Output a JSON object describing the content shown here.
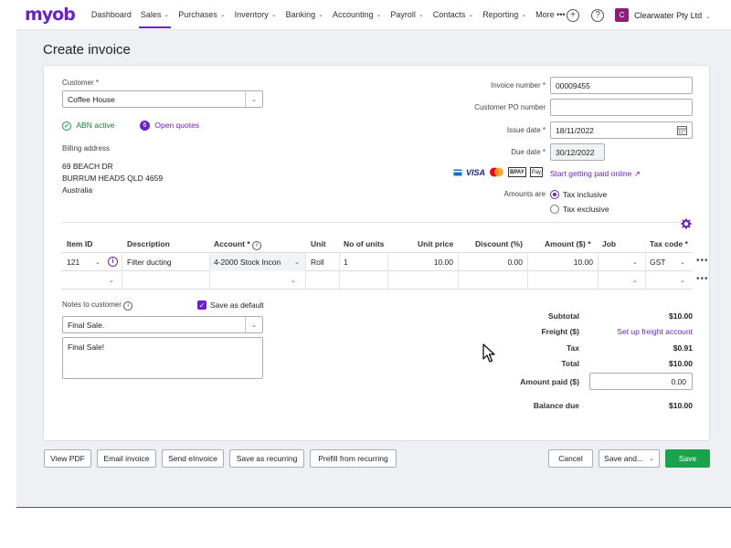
{
  "brand": {
    "logo": "myob",
    "accent": "#6b22c8"
  },
  "nav": {
    "items": [
      {
        "label": "Dashboard",
        "chev": ""
      },
      {
        "label": "Sales",
        "chev": "⌄"
      },
      {
        "label": "Purchases",
        "chev": "⌄"
      },
      {
        "label": "Inventory",
        "chev": "⌄"
      },
      {
        "label": "Banking",
        "chev": "⌄"
      },
      {
        "label": "Accounting",
        "chev": "⌄"
      },
      {
        "label": "Payroll",
        "chev": "⌄"
      },
      {
        "label": "Contacts",
        "chev": "⌄"
      },
      {
        "label": "Reporting",
        "chev": "⌄"
      },
      {
        "label": "More •••",
        "chev": ""
      }
    ],
    "company_initial": "C",
    "company_name": "Clearwater Pty Ltd",
    "add_icon": "+",
    "help_icon": "?"
  },
  "page": {
    "title": "Create invoice"
  },
  "customer": {
    "label": "Customer *",
    "value": "Coffee House",
    "abn_status": "ABN active",
    "quotes_count": "6",
    "quotes_label": "Open quotes",
    "billing_label": "Billing address",
    "address": [
      "69 BEACH DR",
      "BURRUM HEADS QLD 4659",
      "Australia"
    ]
  },
  "invoice": {
    "number_label": "Invoice number *",
    "number": "00009455",
    "po_label": "Customer PO number",
    "po_value": "",
    "issue_label": "Issue date *",
    "issue_date": "18/11/2022",
    "due_label": "Due date *",
    "due_date": "30/12/2022",
    "pay_online": "Start getting paid online",
    "amounts_label": "Amounts are",
    "tax_inclusive": "Tax inclusive",
    "tax_exclusive": "Tax exclusive"
  },
  "table": {
    "headers": {
      "item_id": "Item ID",
      "description": "Description",
      "account": "Account *",
      "unit": "Unit",
      "units": "No of units",
      "price": "Unit price",
      "discount": "Discount (%)",
      "amount": "Amount ($) *",
      "job": "Job",
      "tax": "Tax code *"
    },
    "row1": {
      "item_id": "121",
      "description": "Filter ducting",
      "account": "4-2000  Stock Incon",
      "unit": "Roll",
      "units": "1",
      "price": "10.00",
      "discount": "0.00",
      "amount": "10.00",
      "job": "",
      "tax": "GST"
    }
  },
  "notes": {
    "label": "Notes to customer",
    "save_default": "Save as default",
    "select_value": "Final Sale.",
    "text": "Final Sale!"
  },
  "totals": {
    "subtotal_label": "Subtotal",
    "subtotal": "$10.00",
    "freight_label": "Freight ($)",
    "freight_link": "Set up freight account",
    "tax_label": "Tax",
    "tax": "$0.91",
    "total_label": "Total",
    "total": "$10.00",
    "paid_label": "Amount paid ($)",
    "paid": "0.00",
    "balance_label": "Balance due",
    "balance": "$10.00"
  },
  "footer": {
    "view_pdf": "View PDF",
    "email": "Email invoice",
    "einvoice": "Send eInvoice",
    "recurring": "Save as recurring",
    "prefill": "Prefill from recurring",
    "cancel": "Cancel",
    "save_and": "Save and...",
    "save": "Save"
  }
}
